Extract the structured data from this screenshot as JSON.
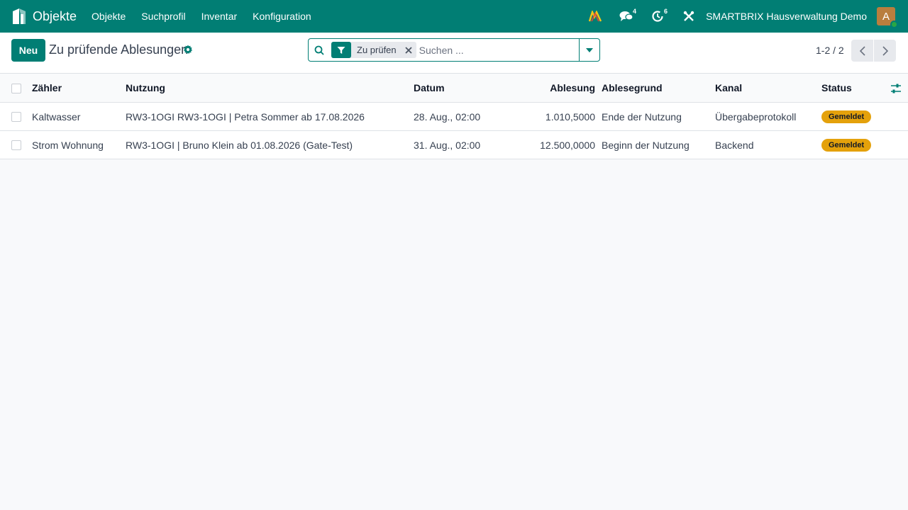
{
  "navbar": {
    "app_name": "Objekte",
    "menu": [
      "Objekte",
      "Suchprofil",
      "Inventar",
      "Konfiguration"
    ],
    "messages_count": "4",
    "activities_count": "6",
    "company": "SMARTBRIX Hausverwaltung Demo",
    "avatar_initial": "A",
    "icons": [
      "app-logo-icon",
      "apps-icon",
      "messages-icon",
      "activities-icon",
      "tools-icon"
    ]
  },
  "control": {
    "new_button": "Neu",
    "title": "Zu prüfende Ablesungen",
    "search": {
      "facet": "Zu prüfen",
      "placeholder": "Suchen ..."
    },
    "pager": "1-2 / 2"
  },
  "table": {
    "columns": {
      "zaehler": "Zähler",
      "nutzung": "Nutzung",
      "datum": "Datum",
      "ablesung": "Ablesung",
      "ablesegrund": "Ablesegrund",
      "kanal": "Kanal",
      "status": "Status"
    },
    "rows": [
      {
        "zaehler": "Kaltwasser",
        "nutzung": "RW3-1OGI RW3-1OGI | Petra Sommer ab 17.08.2026",
        "datum": "28. Aug., 02:00",
        "ablesung": "1.010,5000",
        "ablesegrund": "Ende der Nutzung",
        "kanal": "Übergabeprotokoll",
        "status": "Gemeldet"
      },
      {
        "zaehler": "Strom Wohnung",
        "nutzung": "RW3-1OGI | Bruno Klein ab 01.08.2026 (Gate-Test)",
        "datum": "31. Aug., 02:00",
        "ablesung": "12.500,0000",
        "ablesegrund": "Beginn der Nutzung",
        "kanal": "Backend",
        "status": "Gemeldet"
      }
    ]
  },
  "colors": {
    "brand": "#017e74",
    "status_badge": "#e4a10b"
  }
}
